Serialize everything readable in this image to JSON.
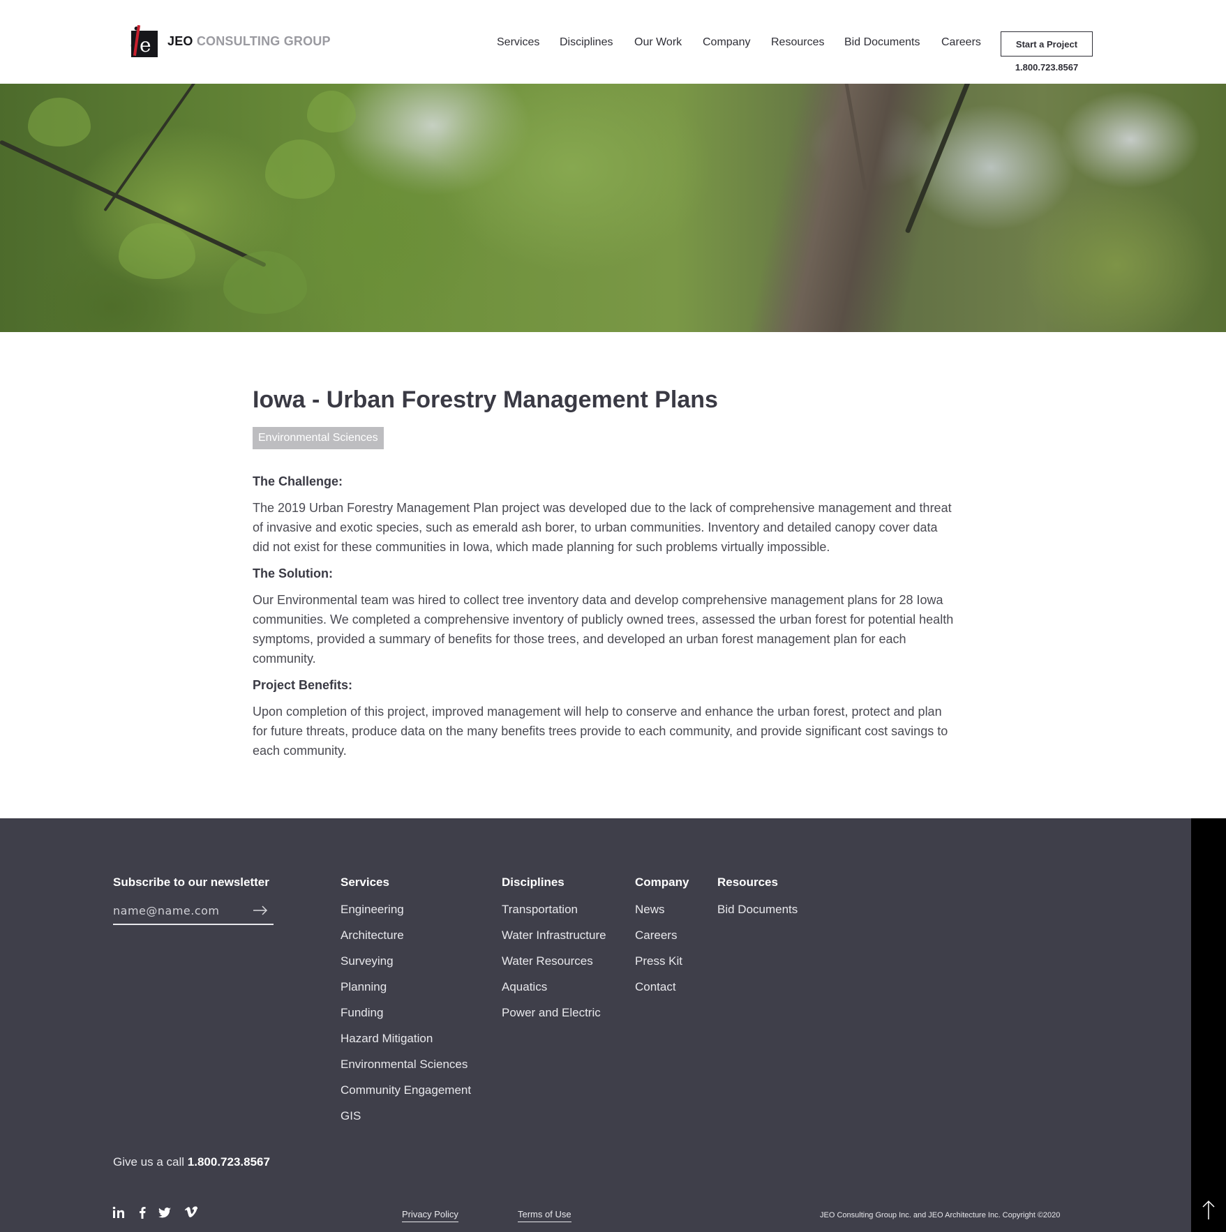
{
  "header": {
    "logo_jeo": "JEO",
    "logo_cg": "CONSULTING GROUP",
    "nav": [
      "Services",
      "Disciplines",
      "Our Work",
      "Company",
      "Resources",
      "Bid Documents",
      "Careers"
    ],
    "cta_label": "Start a Project",
    "phone": "1.800.723.8567"
  },
  "article": {
    "title": "Iowa - Urban Forestry Management Plans",
    "tag": "Environmental Sciences",
    "challenge_heading": "The Challenge:",
    "challenge_text": "The 2019 Urban Forestry Management Plan project was developed due to the lack of comprehensive management and threat of invasive and exotic species, such as emerald ash borer, to urban communities. Inventory and detailed canopy cover data did not exist for these communities in Iowa, which made planning for such problems virtually impossible.",
    "solution_heading": "The Solution:",
    "solution_text": "Our Environmental team was hired to collect tree inventory data and develop comprehensive management plans for 28 Iowa communities. We completed a comprehensive inventory of publicly owned trees, assessed the urban forest for potential health symptoms, provided a summary of benefits for those trees, and developed an urban forest management plan for each community.",
    "benefits_heading": "Project Benefits:",
    "benefits_text": "Upon completion of this project, improved management will help to conserve and enhance the urban forest, protect and plan for future threats, produce data on the many benefits trees provide to each community, and provide significant cost savings to each community."
  },
  "footer": {
    "newsletter_heading": "Subscribe to our newsletter",
    "newsletter_placeholder": "name@name.com",
    "columns": {
      "services": {
        "heading": "Services",
        "items": [
          "Engineering",
          "Architecture",
          "Surveying",
          "Planning",
          "Funding",
          "Hazard Mitigation",
          "Environmental Sciences",
          "Community Engagement",
          "GIS"
        ]
      },
      "disciplines": {
        "heading": "Disciplines",
        "items": [
          "Transportation",
          "Water Infrastructure",
          "Water Resources",
          "Aquatics",
          "Power and Electric"
        ]
      },
      "company": {
        "heading": "Company",
        "items": [
          "News",
          "Careers",
          "Press Kit",
          "Contact"
        ]
      },
      "resources": {
        "heading": "Resources",
        "items": [
          "Bid Documents"
        ]
      }
    },
    "call_prefix": "Give us a call",
    "call_phone": "1.800.723.8567",
    "social_icons": [
      "linkedin-icon",
      "facebook-icon",
      "twitter-icon",
      "vimeo-icon"
    ],
    "privacy": "Privacy Policy",
    "terms": "Terms of Use",
    "copyright": "JEO Consulting Group Inc. and JEO Architecture Inc. Copyright ©2020"
  },
  "colors": {
    "footer_bg": "#3f3f4a",
    "tag_bg": "#bdbdc0",
    "text_dark": "#3a3a44"
  }
}
